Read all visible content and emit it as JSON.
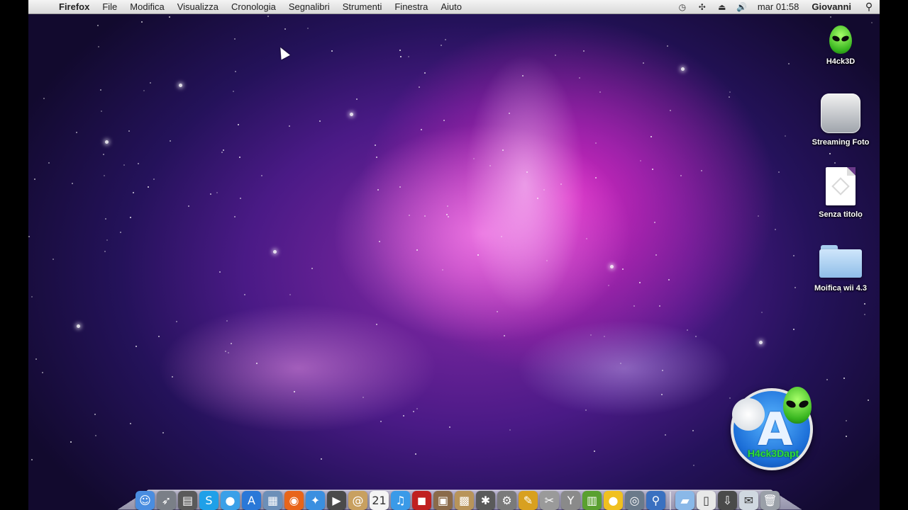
{
  "menubar": {
    "app_name": "Firefox",
    "menus": [
      "File",
      "Modifica",
      "Visualizza",
      "Cronologia",
      "Segnalibri",
      "Strumenti",
      "Finestra",
      "Aiuto"
    ],
    "clock": "mar 01:58",
    "user": "Giovanni"
  },
  "desktop": {
    "icons": [
      {
        "label": "H4ck3D",
        "icon": "alien-icon"
      },
      {
        "label": "Streaming Foto",
        "icon": "apple-cloud-icon"
      },
      {
        "label": "Senza titolo",
        "icon": "document-icon"
      },
      {
        "label": "Moifica wii 4.3",
        "icon": "folder-icon"
      }
    ],
    "badge_text": "H4ck3Dapt"
  },
  "dock": {
    "items": [
      {
        "name": "finder-icon",
        "color": "#4a8de0",
        "glyph": "☺"
      },
      {
        "name": "launchpad-rocket-icon",
        "color": "#7a7f87",
        "glyph": "➶"
      },
      {
        "name": "dashboard-icon",
        "color": "#5a5a5a",
        "glyph": "▤"
      },
      {
        "name": "skype-icon",
        "color": "#1fa0e8",
        "glyph": "S"
      },
      {
        "name": "ichat-bubble-icon",
        "color": "#3aa0e8",
        "glyph": "●"
      },
      {
        "name": "app-store-icon",
        "color": "#2a78d8",
        "glyph": "A"
      },
      {
        "name": "preview-icon",
        "color": "#6c8fb8",
        "glyph": "▦"
      },
      {
        "name": "firefox-icon",
        "color": "#e8651a",
        "glyph": "◉"
      },
      {
        "name": "safari-compass-icon",
        "color": "#3b8fe0",
        "glyph": "✦"
      },
      {
        "name": "facetime-camera-icon",
        "color": "#4a4a4a",
        "glyph": "▶"
      },
      {
        "name": "address-book-icon",
        "color": "#c8a060",
        "glyph": "@"
      },
      {
        "name": "calendar-icon",
        "color": "#f4f4f4",
        "glyph": "21"
      },
      {
        "name": "itunes-icon",
        "color": "#3a9ae8",
        "glyph": "♫"
      },
      {
        "name": "photo-booth-icon",
        "color": "#c02020",
        "glyph": "◼"
      },
      {
        "name": "iphoto-icon",
        "color": "#8a6a4a",
        "glyph": "▣"
      },
      {
        "name": "photo-editor-icon",
        "color": "#b8945a",
        "glyph": "▩"
      },
      {
        "name": "gears-utility-icon",
        "color": "#5a5a5a",
        "glyph": "✱"
      },
      {
        "name": "system-preferences-icon",
        "color": "#7a7a7a",
        "glyph": "⚙"
      },
      {
        "name": "cyberduck-icon",
        "color": "#d8a020",
        "glyph": "✎"
      },
      {
        "name": "utility-tool-icon",
        "color": "#9a9a9a",
        "glyph": "✂"
      },
      {
        "name": "martini-glass-icon",
        "color": "#8a8a8a",
        "glyph": "Y"
      },
      {
        "name": "photo-viewer-icon",
        "color": "#5aa030",
        "glyph": "▥"
      },
      {
        "name": "rubber-duck-icon",
        "color": "#f0c020",
        "glyph": "●"
      },
      {
        "name": "disk-utility-icon",
        "color": "#6a7a8a",
        "glyph": "◎"
      },
      {
        "name": "spotlight-search-icon",
        "color": "#3a70c0",
        "glyph": "⚲"
      },
      {
        "name": "applications-folder-icon",
        "color": "#8ab8e8",
        "glyph": "▰"
      },
      {
        "name": "document-stack-icon",
        "color": "#e8e8e8",
        "glyph": "▯"
      },
      {
        "name": "downloads-icon",
        "color": "#4a4a4a",
        "glyph": "⇩"
      },
      {
        "name": "mail-icon",
        "color": "#d0d8e0",
        "glyph": "✉"
      },
      {
        "name": "trash-icon",
        "color": "#9aa0a8",
        "glyph": "🗑"
      }
    ]
  }
}
